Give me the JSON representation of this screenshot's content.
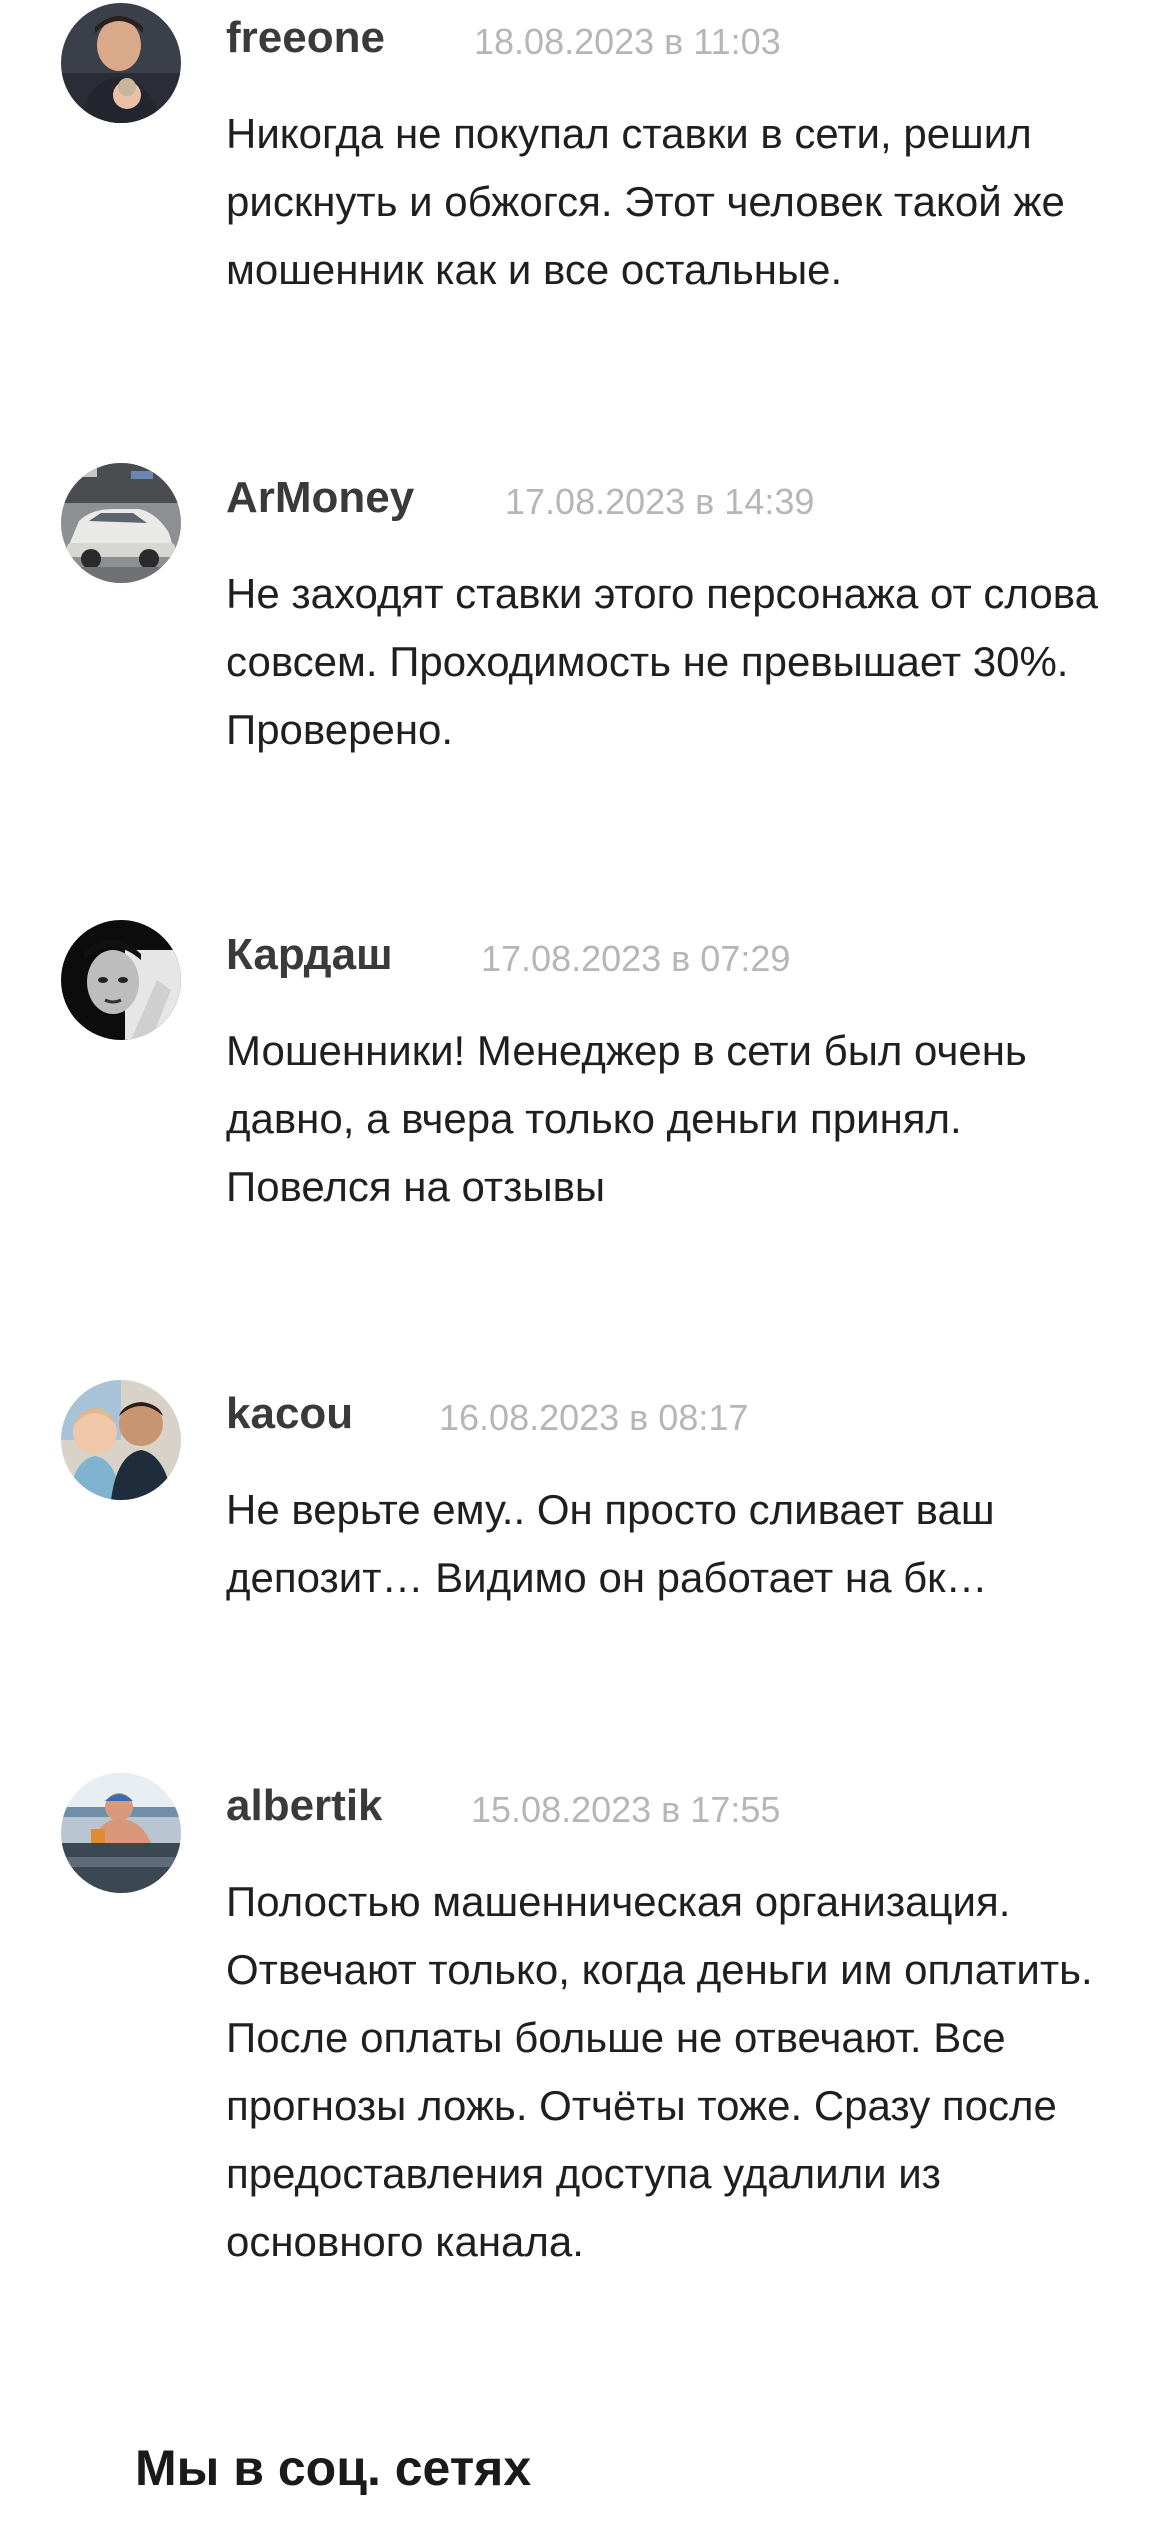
{
  "comments": [
    {
      "author": "freeone",
      "date": "18.08.2023 в 11:03",
      "text": "Никогда не покупал ставки в сети, решил рискнуть и обжогся. Этот человек такой же мошенник как и все остальные.",
      "avatar_icon": "avatar-man-with-baby"
    },
    {
      "author": "ArMoney",
      "date": "17.08.2023 в 14:39",
      "text": "Не заходят ставки этого персонажа от слова совсем. Проходимость не превышает 30%. Проверено.",
      "avatar_icon": "avatar-car"
    },
    {
      "author": "Кардаш",
      "date": "17.08.2023 в 07:29",
      "text": "Мошенники! Менеджер в сети был очень давно, а вчера только деньги принял. Повелся на отзывы",
      "avatar_icon": "avatar-bw-portrait"
    },
    {
      "author": "kacou",
      "date": "16.08.2023 в 08:17",
      "text": "Не верьте ему.. Он просто сливает ваш депозит… Видимо он работает на бк…",
      "avatar_icon": "avatar-man-with-child"
    },
    {
      "author": "albertik",
      "date": "15.08.2023 в 17:55",
      "text": "Полостью машенническая организация. Отвечают только, когда деньги им оплатить. После оплаты больше не отвечают. Все прогнозы ложь. Отчёты тоже. Сразу после предоставления доступа удалили из основного канала.",
      "avatar_icon": "avatar-pool-photo"
    }
  ],
  "social": {
    "title": "Мы в соц. сетях"
  }
}
